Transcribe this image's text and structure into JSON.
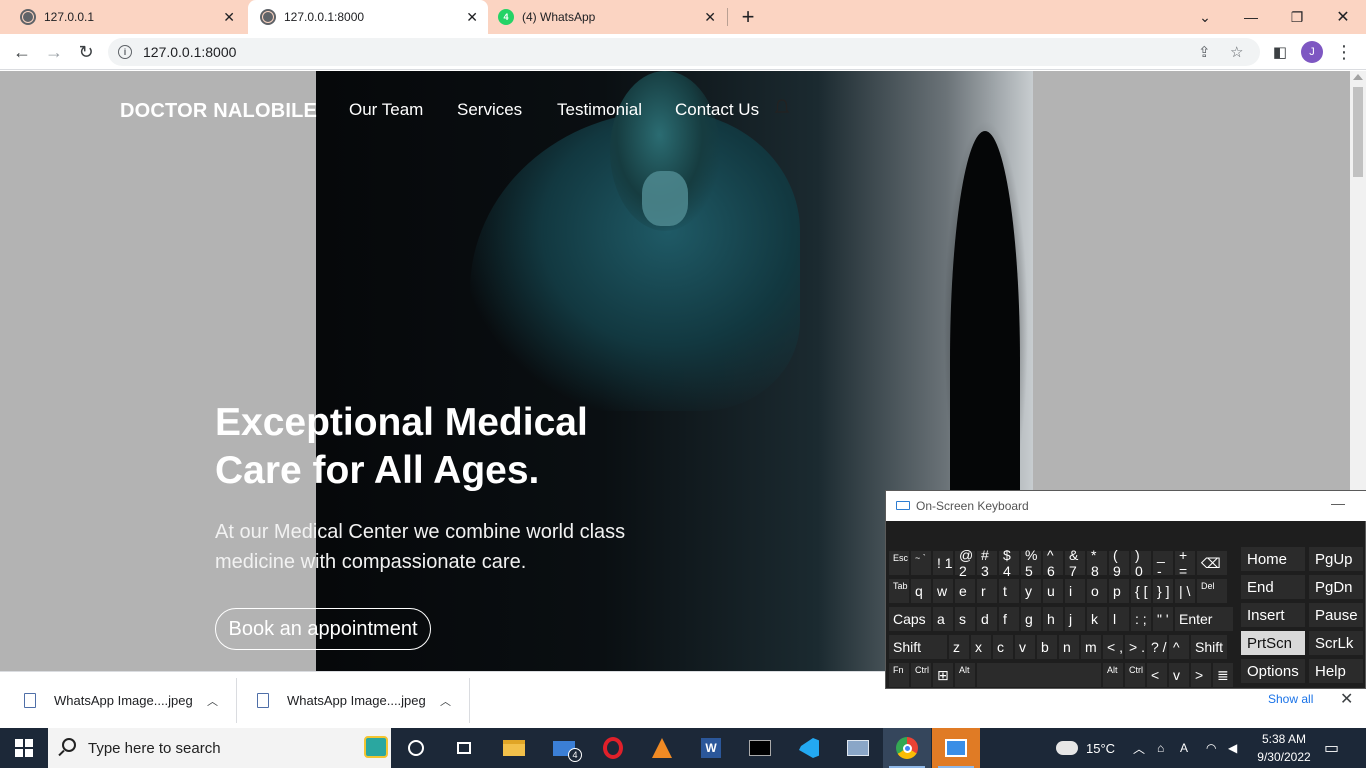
{
  "browser": {
    "tabs": [
      {
        "title": "127.0.0.1",
        "icon": "globe-icon",
        "active": false
      },
      {
        "title": "127.0.0.1:8000",
        "icon": "globe-icon",
        "active": true
      },
      {
        "title": "(4) WhatsApp",
        "icon": "whatsapp-icon",
        "active": false,
        "badge": "4"
      }
    ],
    "new_tab": "+",
    "url": "127.0.0.1:8000",
    "avatar_initial": "J"
  },
  "site": {
    "brand": "DOCTOR NALOBILE",
    "nav": [
      "Our Team",
      "Services",
      "Testimonial",
      "Contact Us"
    ],
    "hero": {
      "title": "Exceptional Medical Care for All Ages.",
      "subtitle": "At our Medical Center we combine world class medicine with compassionate care.",
      "cta": "Book an appointment"
    }
  },
  "downloads": {
    "items": [
      "WhatsApp Image....jpeg",
      "WhatsApp Image....jpeg"
    ],
    "show_all": "Show all"
  },
  "osk": {
    "title": "On-Screen Keyboard",
    "rows": [
      [
        [
          "Esc",
          "sm"
        ],
        [
          "~ `",
          "sm"
        ],
        [
          "! 1",
          ""
        ],
        [
          "@ 2",
          ""
        ],
        [
          "# 3",
          ""
        ],
        [
          "$ 4",
          ""
        ],
        [
          "% 5",
          ""
        ],
        [
          "^ 6",
          ""
        ],
        [
          "& 7",
          ""
        ],
        [
          "* 8",
          ""
        ],
        [
          "( 9",
          ""
        ],
        [
          ") 0",
          ""
        ],
        [
          "_ -",
          ""
        ],
        [
          "+ =",
          ""
        ],
        [
          "⌫",
          ""
        ]
      ],
      [
        [
          "Tab",
          "sm"
        ],
        [
          "q",
          ""
        ],
        [
          "w",
          ""
        ],
        [
          "e",
          ""
        ],
        [
          "r",
          ""
        ],
        [
          "t",
          ""
        ],
        [
          "y",
          ""
        ],
        [
          "u",
          ""
        ],
        [
          "i",
          ""
        ],
        [
          "o",
          ""
        ],
        [
          "p",
          ""
        ],
        [
          "{ [",
          ""
        ],
        [
          "} ]",
          ""
        ],
        [
          "| \\",
          ""
        ],
        [
          "Del",
          "sm"
        ]
      ],
      [
        [
          "Caps",
          ""
        ],
        [
          "a",
          ""
        ],
        [
          "s",
          ""
        ],
        [
          "d",
          ""
        ],
        [
          "f",
          ""
        ],
        [
          "g",
          ""
        ],
        [
          "h",
          ""
        ],
        [
          "j",
          ""
        ],
        [
          "k",
          ""
        ],
        [
          "l",
          ""
        ],
        [
          ": ;",
          ""
        ],
        [
          "\" '",
          ""
        ],
        [
          "Enter",
          ""
        ]
      ],
      [
        [
          "Shift",
          ""
        ],
        [
          "z",
          ""
        ],
        [
          "x",
          ""
        ],
        [
          "c",
          ""
        ],
        [
          "v",
          ""
        ],
        [
          "b",
          ""
        ],
        [
          "n",
          ""
        ],
        [
          "m",
          ""
        ],
        [
          "< ,",
          ""
        ],
        [
          "> .",
          ""
        ],
        [
          "? /",
          ""
        ],
        [
          "^",
          ""
        ],
        [
          "Shift",
          ""
        ]
      ],
      [
        [
          "Fn",
          "sm"
        ],
        [
          "Ctrl",
          "sm"
        ],
        [
          "⊞",
          ""
        ],
        [
          "Alt",
          "sm"
        ],
        [
          "",
          ""
        ],
        [
          "Alt",
          "sm"
        ],
        [
          "Ctrl",
          "sm"
        ],
        [
          "<",
          ""
        ],
        [
          "v",
          ""
        ],
        [
          ">",
          ""
        ],
        [
          "≣",
          ""
        ]
      ]
    ],
    "side_keys": [
      "Home",
      "PgUp",
      "End",
      "PgDn",
      "Insert",
      "Pause",
      "PrtScn",
      "ScrLk",
      "Options",
      "Help"
    ]
  },
  "taskbar": {
    "search_placeholder": "Type here to search",
    "mail_badge": "4",
    "weather": "15°C",
    "time": "5:38 AM",
    "date": "9/30/2022"
  },
  "colors": {
    "tabstrip": "#fbd4c2",
    "page_bg": "#b3b3b3",
    "taskbar": "#1c2838",
    "accent": "#7e57c2"
  }
}
